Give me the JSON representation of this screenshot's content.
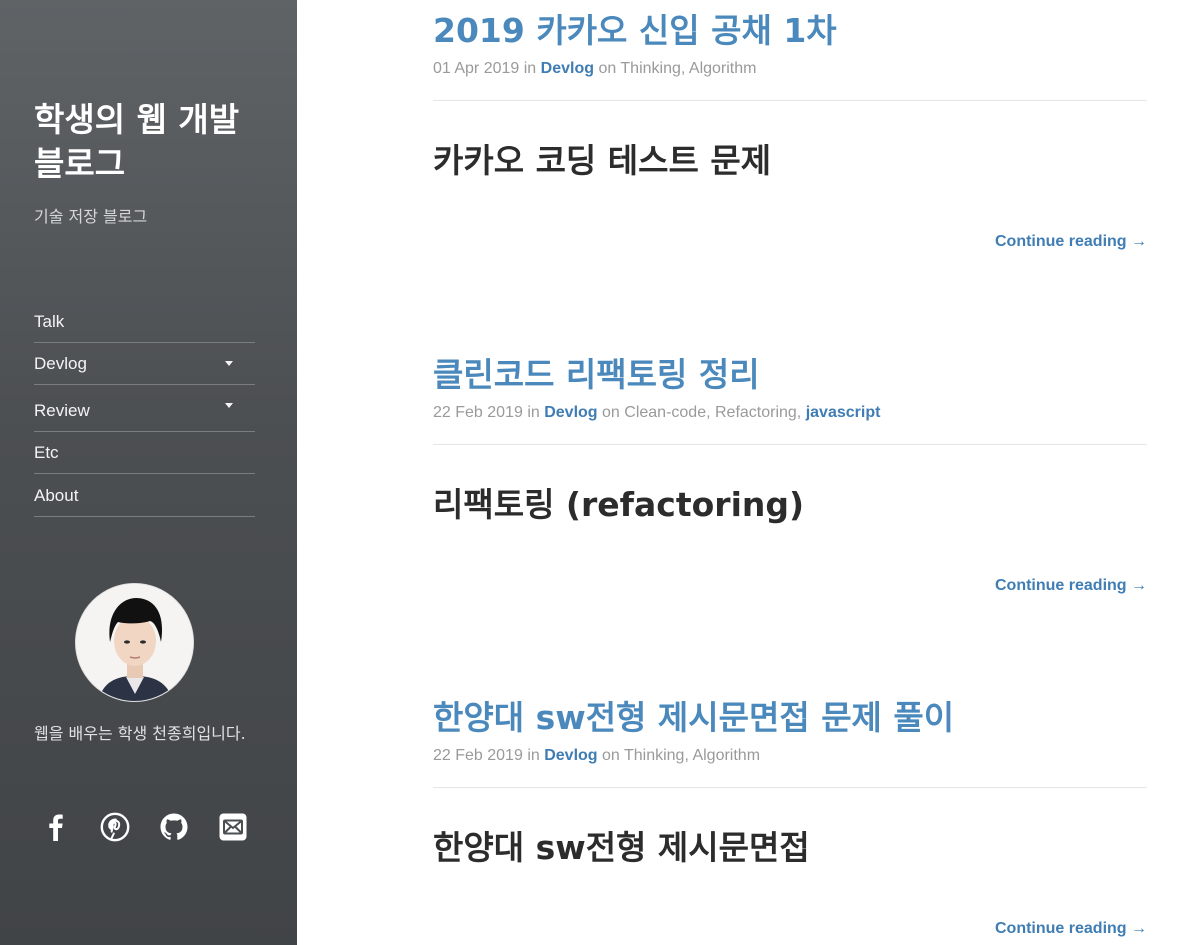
{
  "sidebar": {
    "title": "학생의 웹 개발 블로그",
    "subtitle": "기술 저장 블로그",
    "nav": [
      {
        "label": "Talk",
        "has_dropdown": false
      },
      {
        "label": "Devlog",
        "has_dropdown": true
      },
      {
        "label": "Review",
        "has_dropdown": true
      },
      {
        "label": "Etc",
        "has_dropdown": false
      },
      {
        "label": "About",
        "has_dropdown": false
      }
    ],
    "bio": "웹을 배우는 학생 천종희입니다.",
    "social_icons": [
      "facebook-icon",
      "pinterest-icon",
      "github-icon",
      "mail-icon"
    ]
  },
  "posts": [
    {
      "title": "2019 카카오 신입 공채 1차",
      "date": "01 Apr 2019",
      "in_word": "in",
      "category": "Devlog",
      "on_word": "on",
      "tags": "Thinking, Algorithm",
      "tag_link": "",
      "excerpt": "카카오 코딩 테스트 문제",
      "continue": "Continue reading →"
    },
    {
      "title": "클린코드 리팩토링 정리",
      "date": "22 Feb 2019",
      "in_word": "in",
      "category": "Devlog",
      "on_word": "on",
      "tags": "Clean-code, Refactoring,",
      "tag_link": "javascript",
      "excerpt": "리팩토링 (refactoring)",
      "continue": "Continue reading →"
    },
    {
      "title": "한양대 sw전형 제시문면접 문제 풀이",
      "date": "22 Feb 2019",
      "in_word": "in",
      "category": "Devlog",
      "on_word": "on",
      "tags": "Thinking, Algorithm",
      "tag_link": "",
      "excerpt": "한양대 sw전형 제시문면접",
      "continue": "Continue reading →"
    }
  ],
  "colors": {
    "link": "#4b89bd",
    "sidebar_bg": "#4c4f52",
    "meta": "#9a9a9a"
  }
}
